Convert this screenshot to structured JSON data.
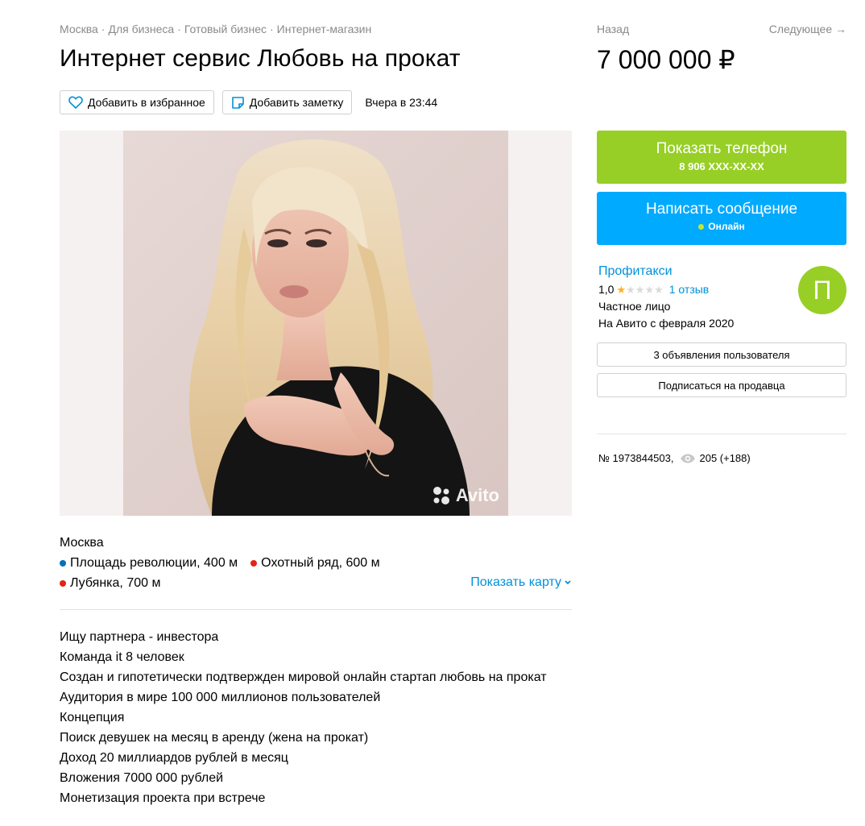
{
  "breadcrumb": [
    "Москва",
    "Для бизнеса",
    "Готовый бизнес",
    "Интернет-магазин"
  ],
  "breadcrumb_sep": "·",
  "title": "Интернет сервис Любовь на прокат",
  "actions": {
    "favorite_label": "Добавить в избранное",
    "note_label": "Добавить заметку",
    "date": "Вчера в 23:44"
  },
  "gallery": {
    "watermark": "Avito"
  },
  "location": {
    "city": "Москва",
    "metro": [
      {
        "name": "Площадь революции, 400 м",
        "color": "#0072ba"
      },
      {
        "name": "Охотный ряд, 600 м",
        "color": "#e42313"
      },
      {
        "name": "Лубянка, 700 м",
        "color": "#e42313"
      }
    ],
    "show_map": "Показать карту"
  },
  "description": [
    "Ищу партнера - инвестора",
    "Команда it 8 человек",
    "Создан и гипотетически подтвержден мировой онлайн стартап любовь на прокат",
    "Аудитория в мире 100 000 миллионов пользователей",
    "Концепция",
    "Поиск девушек на месяц в аренду (жена на прокат)",
    "Доход 20 миллиардов рублей в месяц",
    "Вложения 7000 000 рублей",
    "Монетизация проекта при встрече"
  ],
  "nav": {
    "back": "Назад",
    "next": "Следующее →"
  },
  "price": "7 000 000 ₽",
  "contact": {
    "phone_label": "Показать телефон",
    "phone_masked": "8 906 XXX-XX-XX",
    "message_label": "Написать сообщение",
    "online_label": "Онлайн"
  },
  "seller": {
    "name": "Профитакси",
    "rating": "1,0",
    "stars_filled": 1,
    "stars_total": 5,
    "reviews": "1 отзыв",
    "type": "Частное лицо",
    "since": "На Авито с февраля 2020",
    "avatar_letter": "П",
    "listings_button": "3 объявления пользователя",
    "subscribe_button": "Подписаться на продавца"
  },
  "item": {
    "number": "№ 1973844503,",
    "views": "205 (+188)"
  },
  "colors": {
    "link": "#0091d9",
    "phone_button": "#97cf26",
    "message_button": "#00aaff",
    "star_filled": "#ffb021",
    "star_empty": "#dadada"
  }
}
